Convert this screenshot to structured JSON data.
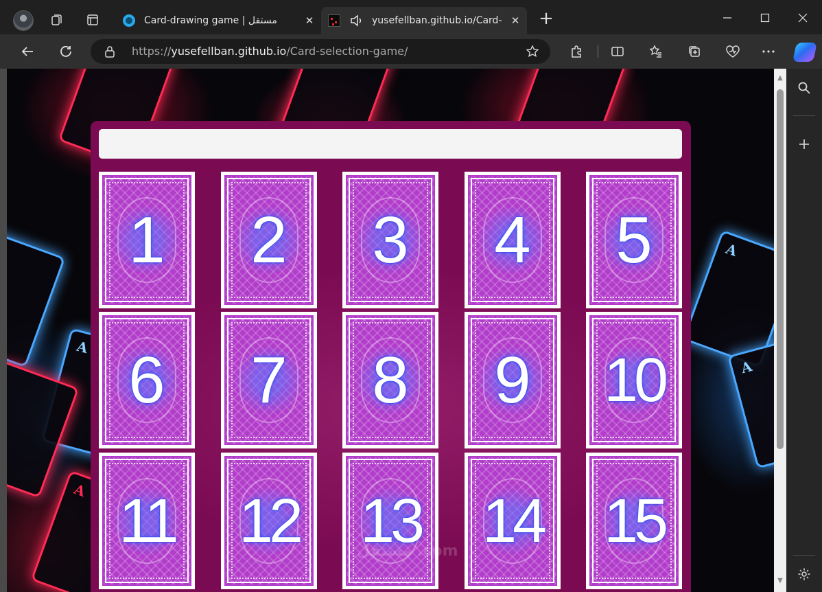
{
  "browser": {
    "tabs": [
      {
        "title": "Card-drawing game | مستقل",
        "favicon": "mostaql-icon",
        "active": false
      },
      {
        "title": "yusefellban.github.io/Card-selection-game/",
        "favicon": "game-icon",
        "active": true,
        "audio": true
      }
    ],
    "address": {
      "scheme": "https://",
      "domain": "yusefellban.github.io",
      "path": "/Card-selection-game/"
    }
  },
  "page": {
    "result_text": "",
    "cards": [
      {
        "label": "1"
      },
      {
        "label": "2"
      },
      {
        "label": "3"
      },
      {
        "label": "4"
      },
      {
        "label": "5"
      },
      {
        "label": "6"
      },
      {
        "label": "7"
      },
      {
        "label": "8"
      },
      {
        "label": "9"
      },
      {
        "label": "10"
      },
      {
        "label": "11"
      },
      {
        "label": "12"
      },
      {
        "label": "13"
      },
      {
        "label": "14"
      },
      {
        "label": "15"
      }
    ],
    "watermark": "مستقل .com"
  },
  "colors": {
    "panel": "#7a0a52",
    "card_back": "#b23dcb",
    "accent_neon_pink": "#ff2b55",
    "accent_neon_blue": "#4aa8ff"
  }
}
